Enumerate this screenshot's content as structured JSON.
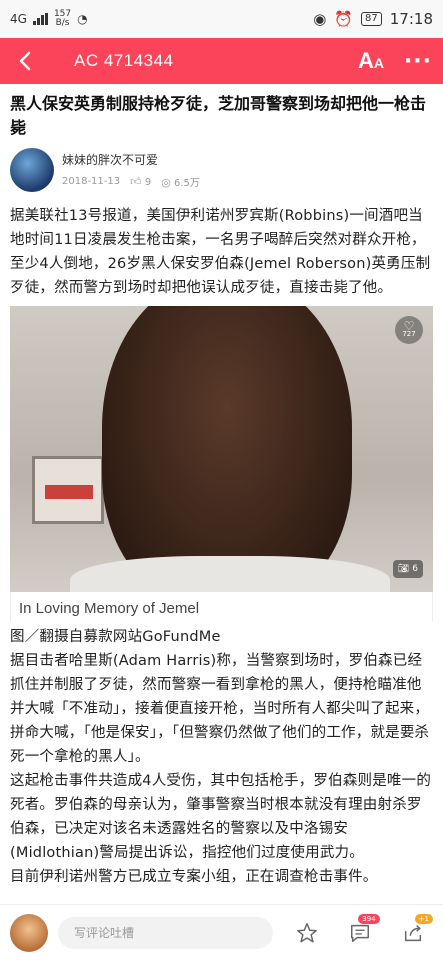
{
  "status_bar": {
    "network": "4G",
    "speed_value": "157",
    "speed_unit": "B/s",
    "battery": "87",
    "time": "17:18"
  },
  "nav": {
    "title": "AC 4714344",
    "font_icon_big": "A",
    "font_icon_small": "A",
    "more_icon": "···"
  },
  "article": {
    "headline": "黑人保安英勇制服持枪歹徒，芝加哥警察到场却把他一枪击毙",
    "author_name": "妹妹的胖次不可爱",
    "date": "2018-11-13",
    "likes": "9",
    "views": "6.5万",
    "paragraph1": "据美联社13号报道，美国伊利诺州罗宾斯(Robbins)一间酒吧当地时间11日凌晨发生枪击案，一名男子喝醉后突然对群众开枪，至少4人倒地，26岁黑人保安罗伯森(Jemel Roberson)英勇压制歹徒，然而警方到场时却把他误认成歹徒，直接击毙了他。",
    "photo_likes": "727",
    "photo_count": "6",
    "photo_caption": "In Loving Memory of Jemel",
    "photo_credit": "图／翻摄自募款网站GoFundMe",
    "paragraph2": "据目击者哈里斯(Adam Harris)称，当警察到场时，罗伯森已经抓住并制服了歹徒，然而警察一看到拿枪的黑人，便持枪瞄准他并大喊「不准动」，接着便直接开枪，当时所有人都尖叫了起来，拼命大喊，「他是保安」，「但警察仍然做了他们的工作，就是要杀死一个拿枪的黑人」。",
    "paragraph3": "这起枪击事件共造成4人受伤，其中包括枪手，罗伯森则是唯一的死者。罗伯森的母亲认为，肇事警察当时根本就没有理由射杀罗伯森，已决定对该名未透露姓名的警察以及中洛锡安(Midlothian)警局提出诉讼，指控他们过度使用武力。",
    "paragraph4": "目前伊利诺州警方已成立专案小组，正在调查枪击事件。"
  },
  "bottom_bar": {
    "comment_placeholder": "写评论吐槽",
    "comments_badge": "394",
    "share_badge": "+1"
  },
  "colors": {
    "brand_red": "#fb4459",
    "badge_orange": "#f7a823"
  }
}
